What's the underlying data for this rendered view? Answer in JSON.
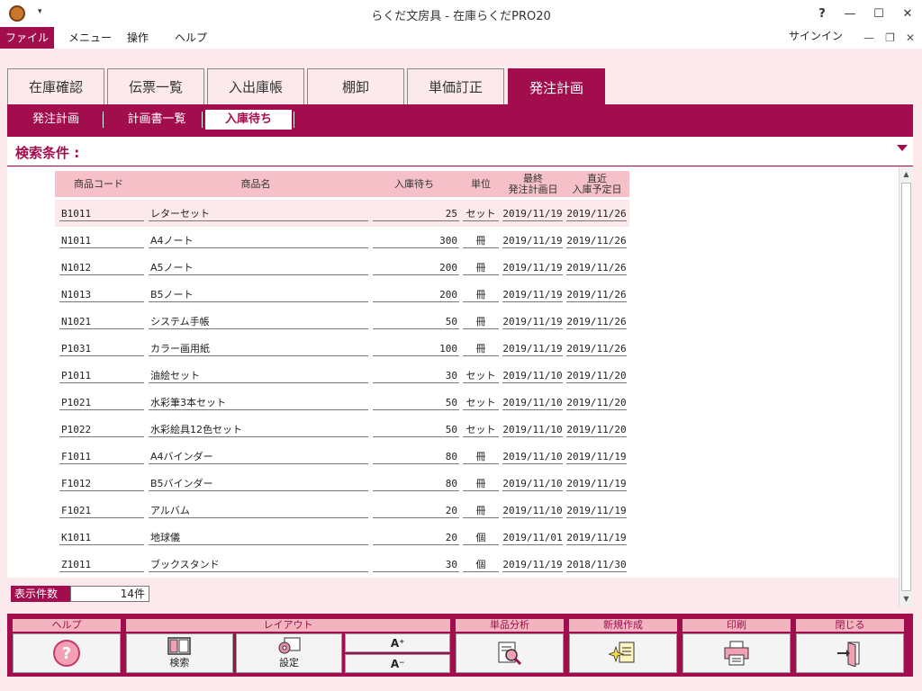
{
  "window": {
    "title": "らくだ文房具 - 在庫らくだPRO20",
    "help_glyph": "?",
    "minimize_glyph": "—",
    "maximize_glyph": "☐",
    "close_glyph": "✕",
    "caret_glyph": "▾"
  },
  "menu": {
    "items": [
      "ファイル",
      "メニュー",
      "操作",
      "ヘルプ"
    ],
    "signin": "サインイン",
    "mdi_minimize": "—",
    "mdi_restore": "❐",
    "mdi_close": "✕"
  },
  "tabs": [
    "在庫確認",
    "伝票一覧",
    "入出庫帳",
    "棚卸",
    "単価訂正",
    "発注計画"
  ],
  "active_tab": "発注計画",
  "subtabs": [
    "発注計画",
    "計画書一覧",
    "入庫待ち"
  ],
  "active_subtab": "入庫待ち",
  "search": {
    "label": "検索条件 :"
  },
  "table": {
    "columns": [
      "商品コード",
      "商品名",
      "入庫待ち",
      "単位",
      "最終\n発注計画日",
      "直近\n入庫予定日"
    ],
    "rows": [
      [
        "B1011",
        "レターセット",
        "25",
        "セット",
        "2019/11/19",
        "2019/11/26"
      ],
      [
        "N1011",
        "A4ノート",
        "300",
        "冊",
        "2019/11/19",
        "2019/11/26"
      ],
      [
        "N1012",
        "A5ノート",
        "200",
        "冊",
        "2019/11/19",
        "2019/11/26"
      ],
      [
        "N1013",
        "B5ノート",
        "200",
        "冊",
        "2019/11/19",
        "2019/11/26"
      ],
      [
        "N1021",
        "システム手帳",
        "50",
        "冊",
        "2019/11/19",
        "2019/11/26"
      ],
      [
        "P1031",
        "カラー画用紙",
        "100",
        "冊",
        "2019/11/19",
        "2019/11/26"
      ],
      [
        "P1011",
        "油絵セット",
        "30",
        "セット",
        "2019/11/10",
        "2019/11/20"
      ],
      [
        "P1021",
        "水彩筆3本セット",
        "50",
        "セット",
        "2019/11/10",
        "2019/11/20"
      ],
      [
        "P1022",
        "水彩絵具12色セット",
        "50",
        "セット",
        "2019/11/10",
        "2019/11/20"
      ],
      [
        "F1011",
        "A4バインダー",
        "80",
        "冊",
        "2019/11/10",
        "2019/11/19"
      ],
      [
        "F1012",
        "B5バインダー",
        "80",
        "冊",
        "2019/11/10",
        "2019/11/19"
      ],
      [
        "F1021",
        "アルバム",
        "20",
        "冊",
        "2019/11/10",
        "2019/11/19"
      ],
      [
        "K1011",
        "地球儀",
        "20",
        "個",
        "2019/11/01",
        "2019/11/19"
      ],
      [
        "Z1011",
        "ブックスタンド",
        "30",
        "個",
        "2019/11/19",
        "2018/11/30"
      ]
    ]
  },
  "count": {
    "label": "表示件数",
    "value": "14件"
  },
  "footer": {
    "help": {
      "title": "ヘルプ"
    },
    "layout": {
      "title": "レイアウト",
      "search_label": "検索",
      "settings_label": "設定",
      "font_up": "A⁺",
      "font_down": "A⁻"
    },
    "analysis": {
      "title": "単品分析"
    },
    "create": {
      "title": "新規作成"
    },
    "print": {
      "title": "印刷"
    },
    "close": {
      "title": "閉じる"
    }
  },
  "colors": {
    "accent": "#a20d4d",
    "header_pink": "#f6c0c8",
    "bg_pink": "#fbe9ec"
  }
}
